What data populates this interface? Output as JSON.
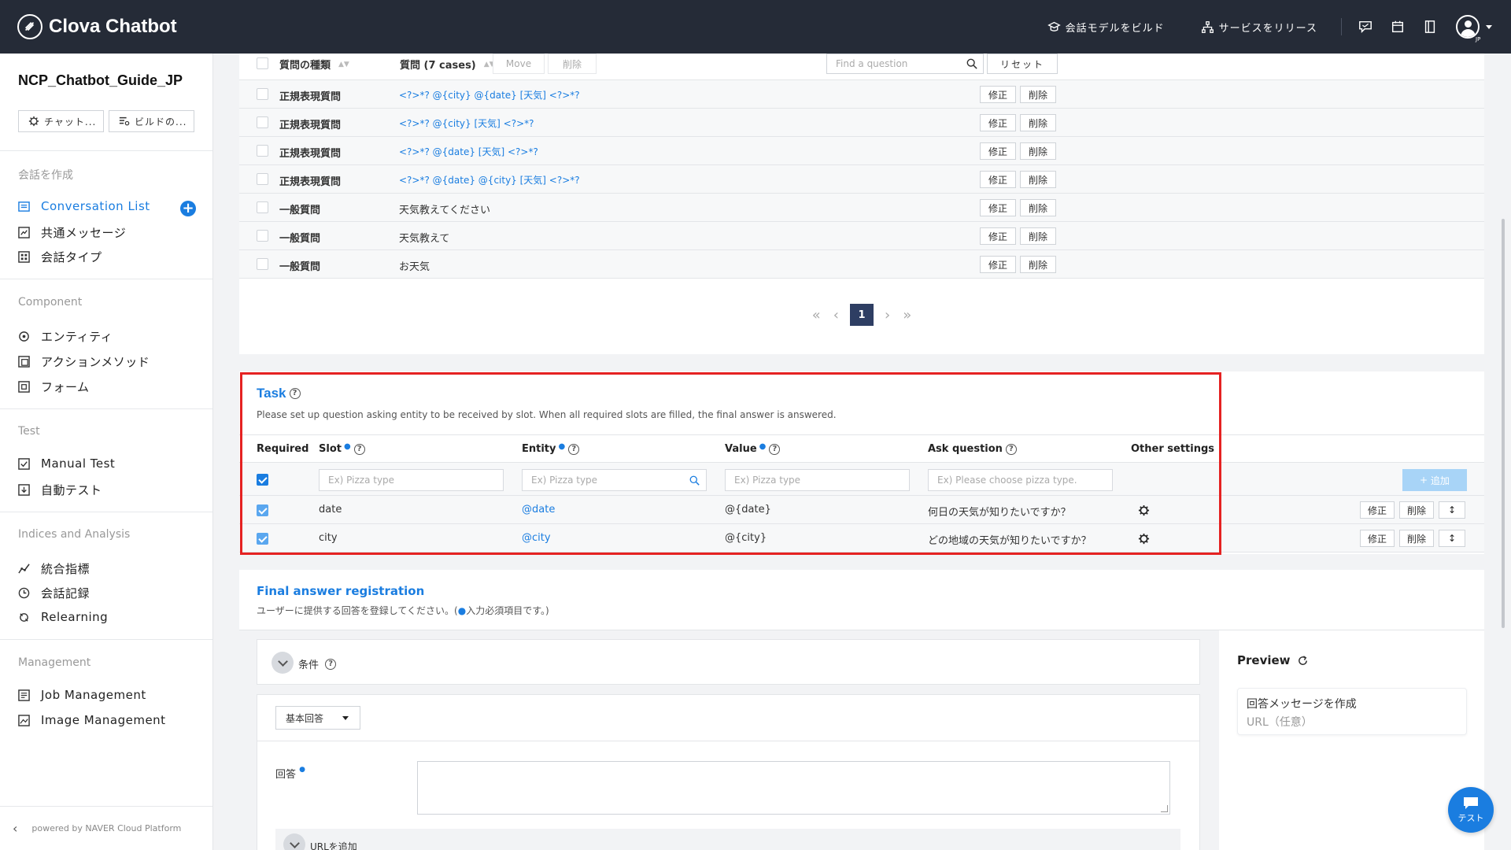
{
  "app": {
    "title": "Clova Chatbot"
  },
  "topnav": {
    "build": "会話モデルをビルド",
    "release": "サービスをリリース",
    "lang": "JP"
  },
  "sidebar": {
    "project": "NCP_Chatbot_Guide_JP",
    "btn_chat": "チャット...",
    "btn_build": "ビルドの...",
    "section_create": "会話を作成",
    "conversation_list": "Conversation List",
    "common_message": "共通メッセージ",
    "conversation_type": "会話タイプ",
    "section_component": "Component",
    "entity": "エンティティ",
    "action_method": "アクションメソッド",
    "form": "フォーム",
    "section_test": "Test",
    "manual_test": "Manual Test",
    "auto_test": "自動テスト",
    "section_indices": "Indices and Analysis",
    "metrics": "統合指標",
    "logs": "会話記録",
    "relearning": "Relearning",
    "section_management": "Management",
    "job_management": "Job Management",
    "image_management": "Image Management",
    "footer": "powered by NAVER Cloud Platform"
  },
  "questions": {
    "col_type": "質問の種類",
    "col_question": "質問 (7 cases)",
    "move": "Move",
    "delete_all": "削除",
    "search_placeholder": "Find a question",
    "reset": "リセット",
    "edit": "修正",
    "delete": "削除",
    "rows": [
      {
        "type": "正規表現質問",
        "question": "<?>*? @{city} @{date} [天気] <?>*?",
        "style": "blue"
      },
      {
        "type": "正規表現質問",
        "question": "<?>*? @{city} [天気] <?>*?",
        "style": "blue"
      },
      {
        "type": "正規表現質問",
        "question": "<?>*? @{date} [天気] <?>*?",
        "style": "blue"
      },
      {
        "type": "正規表現質問",
        "question": "<?>*? @{date} @{city} [天気] <?>*?",
        "style": "blue"
      },
      {
        "type": "一般質問",
        "question": "天気教えてください",
        "style": "dark"
      },
      {
        "type": "一般質問",
        "question": "天気教えて",
        "style": "dark"
      },
      {
        "type": "一般質問",
        "question": "お天気",
        "style": "dark"
      }
    ],
    "page": "1"
  },
  "task": {
    "title": "Task",
    "description": "Please set up question asking entity to be received by slot. When all required slots are filled, the final answer is answered.",
    "col_required": "Required",
    "col_slot": "Slot",
    "col_entity": "Entity",
    "col_value": "Value",
    "col_ask": "Ask question",
    "col_other": "Other settings",
    "ph_slot": "Ex) Pizza type",
    "ph_entity": "Ex) Pizza type",
    "ph_value": "Ex) Pizza type",
    "ph_ask": "Ex) Please choose pizza type.",
    "add": "追加",
    "edit": "修正",
    "delete": "削除",
    "rows": [
      {
        "slot": "date",
        "entity": "@date",
        "value": "@{date}",
        "ask": "何日の天気が知りたいですか？"
      },
      {
        "slot": "city",
        "entity": "@city",
        "value": "@{city}",
        "ask": "どの地域の天気が知りたいですか？"
      }
    ]
  },
  "final": {
    "title": "Final answer registration",
    "description": "ユーザーに提供する回答を登録してください。(",
    "description_tail": "入力必須項目です。)",
    "condition": "条件",
    "answer_type": "基本回答",
    "answer_label": "回答",
    "add_url": "URLを追加",
    "preview": "Preview",
    "preview_line1": "回答メッセージを作成",
    "preview_line2": "URL（任意）"
  },
  "fab": {
    "label": "テスト"
  },
  "colors": {
    "accent": "#1a7de0",
    "topbar": "#252b37",
    "highlight": "#e52222"
  }
}
